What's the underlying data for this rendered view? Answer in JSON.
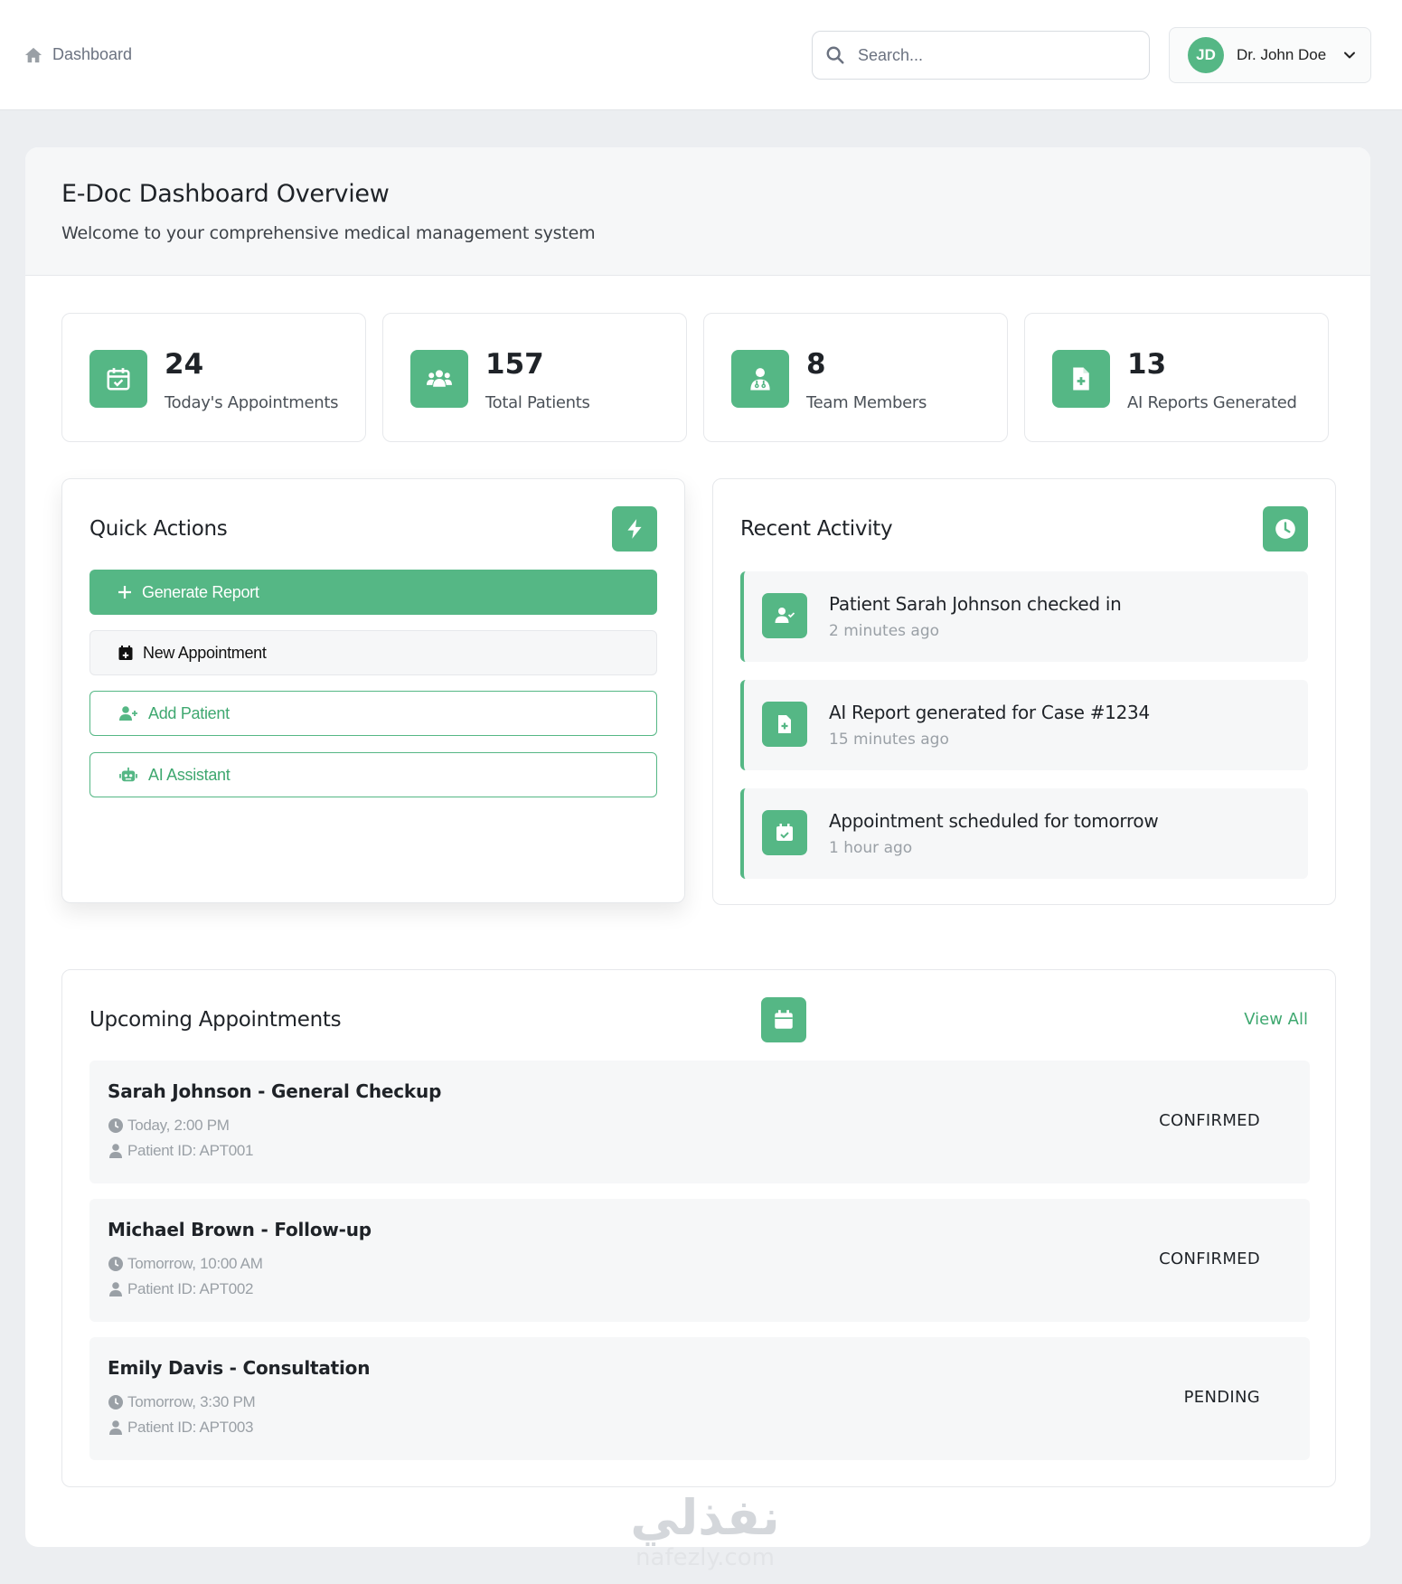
{
  "header": {
    "breadcrumb": "Dashboard",
    "search_placeholder": "Search...",
    "user": {
      "initials": "JD",
      "name": "Dr. John Doe"
    }
  },
  "overview": {
    "title": "E-Doc Dashboard Overview",
    "subtitle": "Welcome to your comprehensive medical management system"
  },
  "stats": [
    {
      "value": "24",
      "label": "Today's Appointments",
      "icon": "calendar-check-icon"
    },
    {
      "value": "157",
      "label": "Total Patients",
      "icon": "users-icon"
    },
    {
      "value": "8",
      "label": "Team Members",
      "icon": "doctor-icon"
    },
    {
      "value": "13",
      "label": "AI Reports Generated",
      "icon": "file-medical-icon"
    }
  ],
  "quick_actions": {
    "title": "Quick Actions",
    "buttons": [
      {
        "label": "Generate Report",
        "icon": "plus-icon"
      },
      {
        "label": "New Appointment",
        "icon": "calendar-plus-icon"
      },
      {
        "label": "Add Patient",
        "icon": "user-plus-icon"
      },
      {
        "label": "AI Assistant",
        "icon": "robot-icon"
      }
    ]
  },
  "recent_activity": {
    "title": "Recent Activity",
    "items": [
      {
        "text": "Patient Sarah Johnson checked in",
        "time": "2 minutes ago",
        "icon": "user-check-icon"
      },
      {
        "text": "AI Report generated for Case #1234",
        "time": "15 minutes ago",
        "icon": "file-medical-icon"
      },
      {
        "text": "Appointment scheduled for tomorrow",
        "time": "1 hour ago",
        "icon": "calendar-check-icon"
      }
    ]
  },
  "appointments": {
    "title": "Upcoming Appointments",
    "view_all": "View All",
    "items": [
      {
        "title": "Sarah Johnson - General Checkup",
        "time": "Today, 2:00 PM",
        "patient_id": "Patient ID: APT001",
        "status": "CONFIRMED"
      },
      {
        "title": "Michael Brown - Follow-up",
        "time": "Tomorrow, 10:00 AM",
        "patient_id": "Patient ID: APT002",
        "status": "CONFIRMED"
      },
      {
        "title": "Emily Davis - Consultation",
        "time": "Tomorrow, 3:30 PM",
        "patient_id": "Patient ID: APT003",
        "status": "PENDING"
      }
    ]
  },
  "watermark": {
    "arabic": "نفذلي",
    "latin": "nafezly.com"
  },
  "colors": {
    "accent": "#55b785",
    "accent_text": "#3fa870",
    "background": "#eceef1"
  }
}
